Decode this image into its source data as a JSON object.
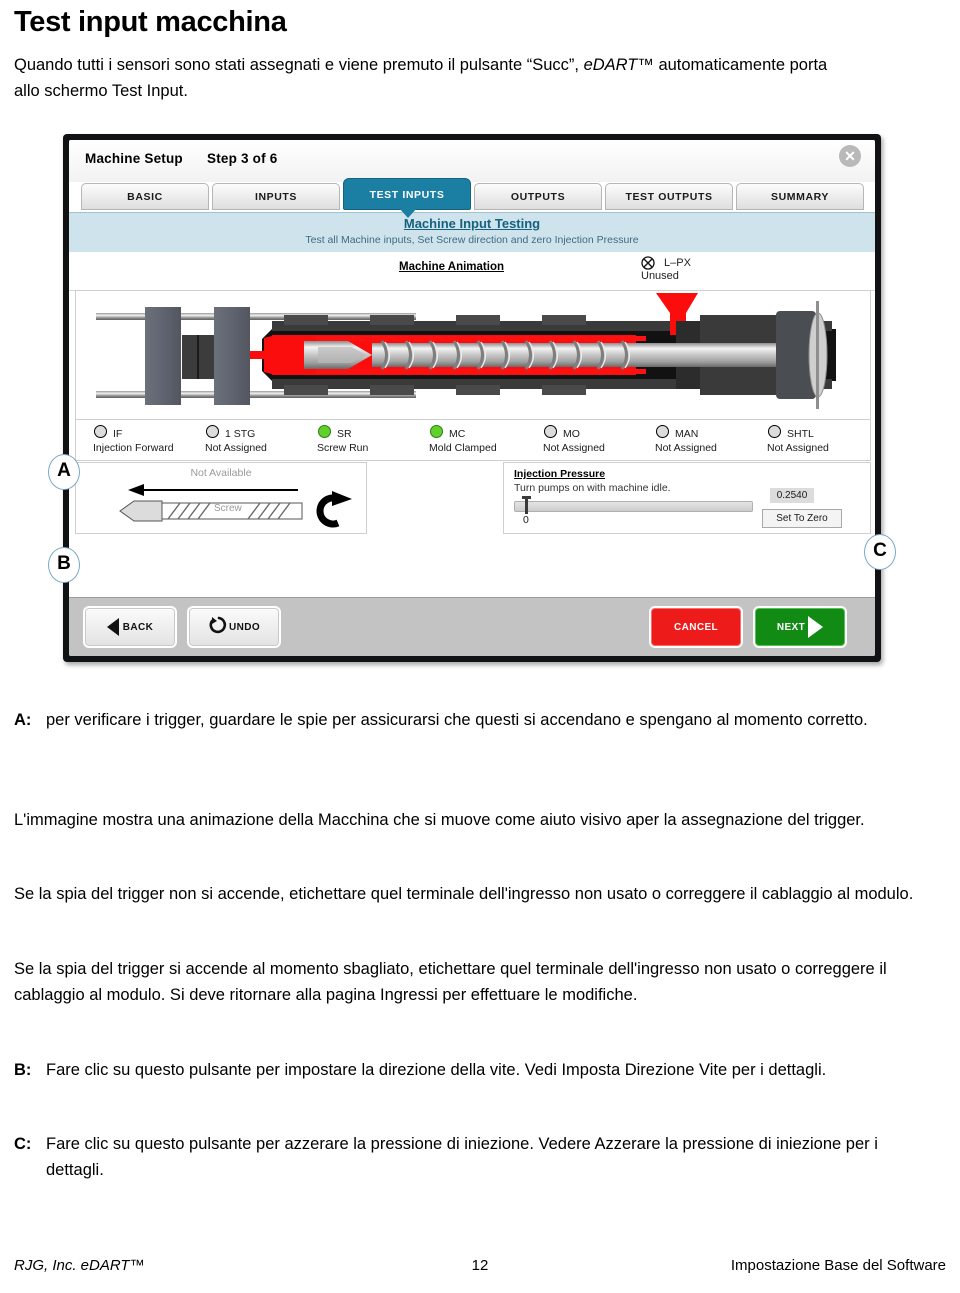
{
  "document": {
    "title": "Test input macchina",
    "intro_before": "Quando tutti i sensori sono stati assegnati e viene premuto il pulsante “Succ”, ",
    "intro_italic": "eDART™",
    "intro_after": " automaticamente porta allo schermo Test Input."
  },
  "screenshot": {
    "titlebar": {
      "app_title": "Machine Setup",
      "step": "Step 3 of 6",
      "close_label": "✕"
    },
    "tabs": [
      {
        "label": "BASIC",
        "active": false
      },
      {
        "label": "INPUTS",
        "active": false
      },
      {
        "label": "TEST INPUTS",
        "active": true
      },
      {
        "label": "OUTPUTS",
        "active": false
      },
      {
        "label": "TEST OUTPUTS",
        "active": false
      },
      {
        "label": "SUMMARY",
        "active": false
      }
    ],
    "blue_panel": {
      "heading": "Machine Input Testing",
      "subheading": "Test all Machine inputs, Set Screw direction and zero Injection Pressure"
    },
    "animation_header": {
      "title": "Machine Animation",
      "lpx_label": "L–PX",
      "lpx_status": "Unused"
    },
    "leds": [
      {
        "abbr": "IF",
        "desc": "Injection Forward",
        "on": false
      },
      {
        "abbr": "1 STG",
        "desc": "Not Assigned",
        "on": false
      },
      {
        "abbr": "SR",
        "desc": "Screw Run",
        "on": true
      },
      {
        "abbr": "MC",
        "desc": "Mold Clamped",
        "on": true
      },
      {
        "abbr": "MO",
        "desc": "Not Assigned",
        "on": false
      },
      {
        "abbr": "MAN",
        "desc": "Not Assigned",
        "on": false
      },
      {
        "abbr": "SHTL",
        "desc": "Not Assigned",
        "on": false
      }
    ],
    "screw_panel": {
      "status": "Not Available",
      "screw_label": "Screw"
    },
    "pressure_panel": {
      "heading": "Injection Pressure",
      "subheading": "Turn pumps on with machine idle.",
      "slider_min": "0",
      "value": "0.2540",
      "set_to_zero": "Set To Zero"
    },
    "buttons": {
      "back": "BACK",
      "undo": "UNDO",
      "cancel": "CANCEL",
      "next": "NEXT"
    },
    "markers": {
      "a": "A",
      "b": "B",
      "c": "C"
    },
    "colors": {
      "accent_blue": "#1b7ea3",
      "panel_blue": "#cfe3ec",
      "led_on": "#5fd12a",
      "cancel_red": "#ee1b1b",
      "next_green": "#128b14",
      "barrel_red": "#ff0000"
    }
  },
  "notes": {
    "a_label": "A:",
    "a_text": "per verificare i trigger, guardare le spie per assicurarsi che questi si accendano e spengano al momento corretto.",
    "p1": "L'immagine mostra una animazione della Macchina che si muove come aiuto visivo aper la assegnazione del trigger.",
    "p2": "Se la spia del trigger non si accende, etichettare quel terminale dell'ingresso non usato o correggere il cablaggio al modulo.",
    "p3": "Se la spia del trigger si accende al momento sbagliato, etichettare quel terminale dell'ingresso non usato o correggere il cablaggio al modulo.  Si deve ritornare alla pagina Ingressi per effettuare le modifiche.",
    "b_label": "B:",
    "b_text": "Fare clic su questo pulsante per impostare la direzione della vite. Vedi Imposta Direzione Vite per i dettagli.",
    "c_label": "C:",
    "c_text": "Fare clic su questo pulsante per azzerare la pressione di iniezione. Vedere Azzerare la pressione di iniezione per i dettagli."
  },
  "footer": {
    "left": "RJG, Inc. eDART™",
    "page": "12",
    "right": "Impostazione Base del Software"
  }
}
